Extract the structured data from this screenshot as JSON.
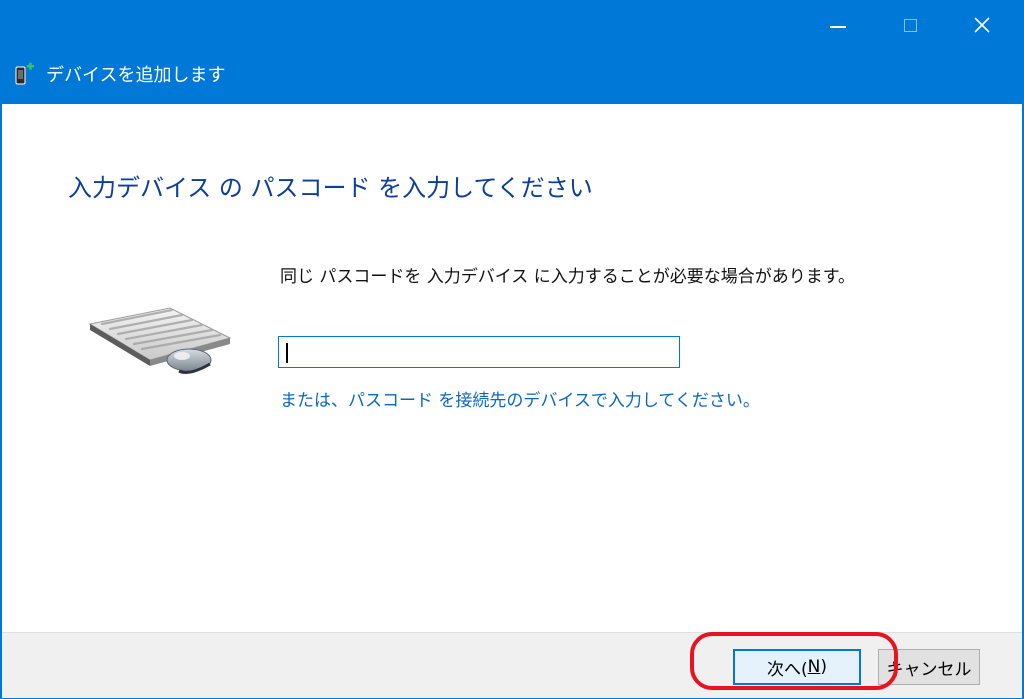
{
  "window": {
    "title": "デバイスを追加します",
    "controls": {
      "minimize": "minimize",
      "maximize": "maximize",
      "close": "close"
    }
  },
  "content": {
    "heading": "入力デバイス の パスコード を入力してください",
    "instruction": "同じ パスコードを 入力デバイス に入力することが必要な場合があります。",
    "passcode": {
      "value": "",
      "placeholder": ""
    },
    "alt_link": "または、パスコード を接続先のデバイスで入力してください。"
  },
  "footer": {
    "next_prefix": "次へ(",
    "next_mnemonic": "N",
    "next_suffix": ")",
    "cancel_label": "キャンセル"
  },
  "annotation": {
    "highlight_color": "#e8131f",
    "highlight_target": "next-button"
  },
  "colors": {
    "titlebar": "#0078d7",
    "heading": "#0b3e9a",
    "link": "#0a66c2",
    "footer_bg": "#f0f0f0"
  },
  "icons": {
    "window_icon": "device-add-icon",
    "illustration": "keyboard-mouse-icon"
  }
}
